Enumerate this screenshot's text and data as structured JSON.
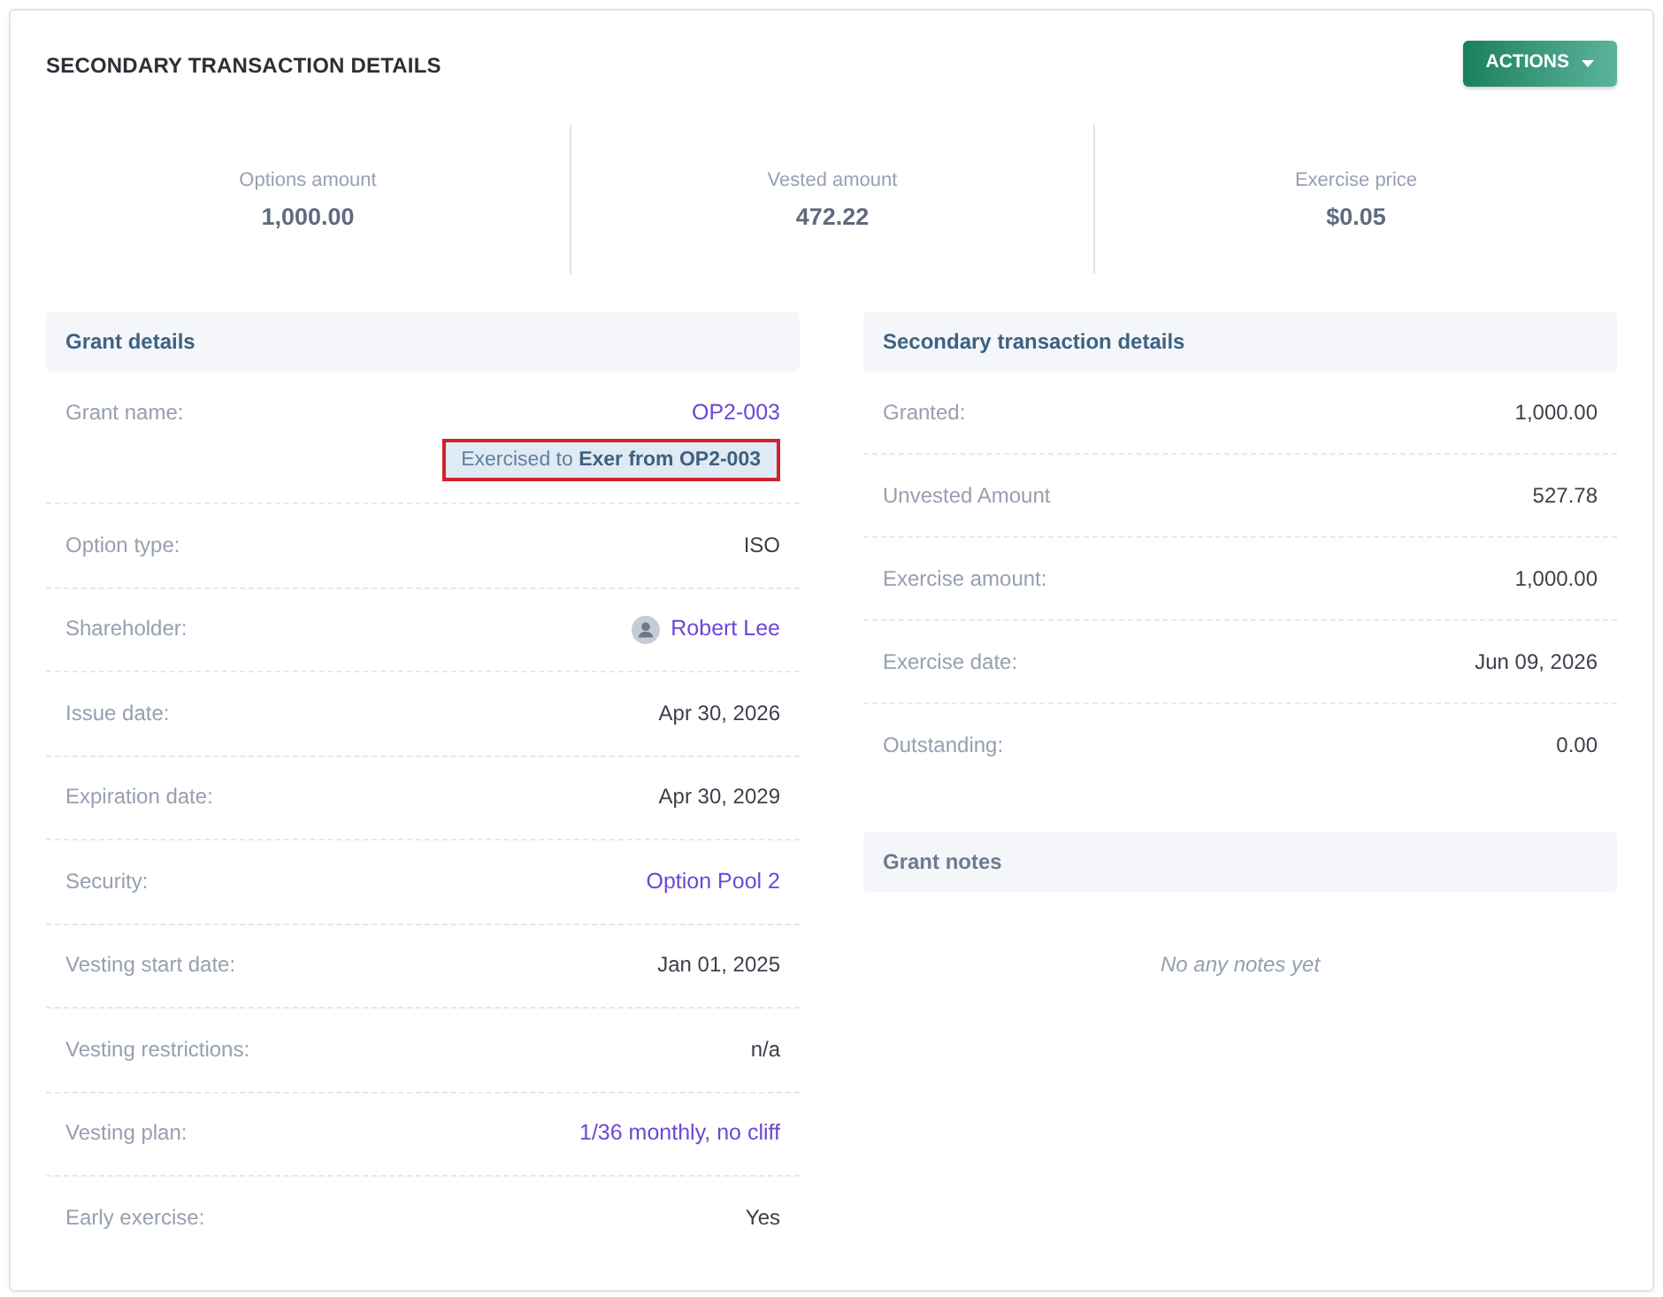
{
  "header": {
    "title": "SECONDARY TRANSACTION DETAILS",
    "actions_button": "ACTIONS"
  },
  "stats": [
    {
      "label": "Options amount",
      "value": "1,000.00"
    },
    {
      "label": "Vested amount",
      "value": "472.22"
    },
    {
      "label": "Exercise price",
      "value": "$0.05"
    }
  ],
  "grant_details": {
    "title": "Grant details",
    "rows": [
      {
        "kind": "link",
        "label": "Grant name:",
        "value": "OP2-003",
        "note": {
          "text": "Exercised to **Exer from OP2-003**",
          "highlighted": true
        }
      },
      {
        "kind": "text",
        "label": "Option type:",
        "value": "ISO"
      },
      {
        "kind": "person",
        "label": "Shareholder:",
        "value": "Robert Lee"
      },
      {
        "kind": "text",
        "label": "Issue date:",
        "value": "Apr 30, 2026"
      },
      {
        "kind": "text",
        "label": "Expiration date:",
        "value": "Apr 30, 2029"
      },
      {
        "kind": "link",
        "label": "Security:",
        "value": "Option Pool 2"
      },
      {
        "kind": "text",
        "label": "Vesting start date:",
        "value": "Jan 01, 2025"
      },
      {
        "kind": "text",
        "label": "Vesting restrictions:",
        "value": "n/a"
      },
      {
        "kind": "link",
        "label": "Vesting plan:",
        "value": "1/36 monthly, no cliff"
      },
      {
        "kind": "text",
        "label": "Early exercise:",
        "value": "Yes"
      }
    ]
  },
  "secondary_transaction_details": {
    "title": "Secondary transaction details",
    "rows": [
      {
        "kind": "text",
        "label": "Granted:",
        "value": "1,000.00"
      },
      {
        "kind": "text",
        "label": "Unvested Amount",
        "value": "527.78"
      },
      {
        "kind": "text",
        "label": "Exercise amount:",
        "value": "1,000.00"
      },
      {
        "kind": "text",
        "label": "Exercise date:",
        "value": "Jun 09, 2026"
      },
      {
        "kind": "text",
        "label": "Outstanding:",
        "value": "0.00"
      }
    ]
  },
  "grant_notes": {
    "title": "Grant notes",
    "empty_message": "No any notes yet"
  }
}
